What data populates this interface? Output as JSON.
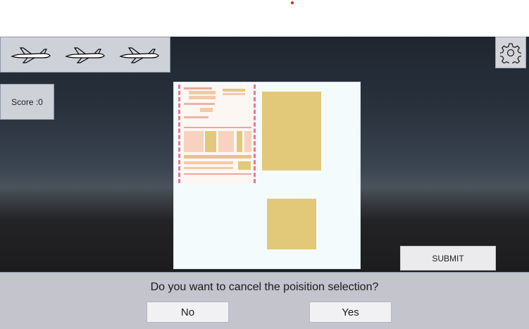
{
  "hud": {
    "lives": [
      "airplane-icon",
      "airplane-icon",
      "airplane-icon"
    ],
    "score_label": "Score :0",
    "settings_icon": "gear-icon"
  },
  "board": {
    "document": "shipping-form-thumbnail",
    "slots": [
      "large-slot",
      "small-slot"
    ]
  },
  "actions": {
    "submit_label": "SUBMIT"
  },
  "dialog": {
    "question": "Do you want to cancel the poisition selection?",
    "no_label": "No",
    "yes_label": "Yes"
  },
  "colors": {
    "slot": "#e2c97a",
    "form_border": "#e07c92",
    "dialog_bg": "#c3c4cc",
    "panel_bg": "#cfd1d8"
  }
}
